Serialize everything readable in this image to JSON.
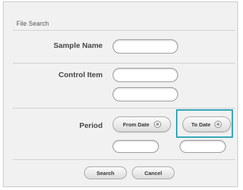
{
  "dialog": {
    "title": "File Search"
  },
  "sample_name": {
    "label": "Sample Name",
    "value": ""
  },
  "control_item": {
    "label": "Control Item",
    "value_1": "",
    "value_2": ""
  },
  "period": {
    "label": "Period",
    "from_label": "From Date",
    "to_label": "To Date",
    "from_value": "",
    "to_value": ""
  },
  "actions": {
    "search_label": "Search",
    "cancel_label": "Cancel"
  },
  "colors": {
    "highlight": "#2ea6b9",
    "panel_background": "#f1f1f1"
  },
  "icons": {
    "stepper": "stepper-icon"
  }
}
